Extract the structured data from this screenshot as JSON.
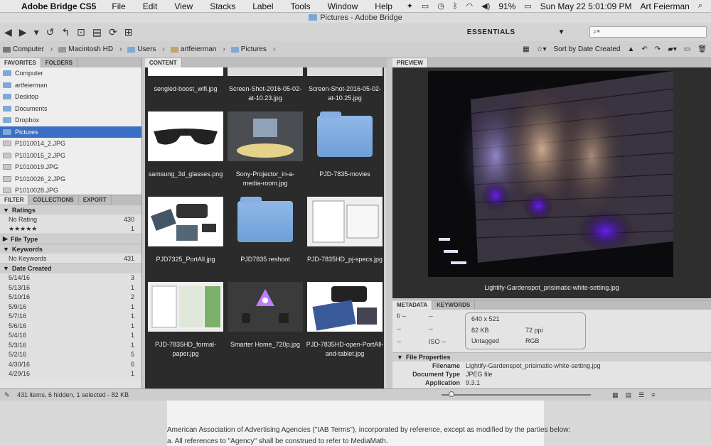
{
  "menubar": {
    "app": "Adobe Bridge CS5",
    "items": [
      "File",
      "Edit",
      "View",
      "Stacks",
      "Label",
      "Tools",
      "Window",
      "Help"
    ],
    "battery": "91%",
    "clock": "Sun May 22  5:01:09 PM",
    "user": "Art Feierman"
  },
  "window": {
    "title": "Pictures - Adobe Bridge"
  },
  "toolbar": {
    "workspace": "ESSENTIALS",
    "search_placeholder": ""
  },
  "pathbar": {
    "crumbs": [
      "Computer",
      "Macintosh HD",
      "Users",
      "artfeierman",
      "Pictures"
    ],
    "sort": "Sort by Date Created"
  },
  "left": {
    "tabs": [
      "FAVORITES",
      "FOLDERS"
    ],
    "favorites": [
      {
        "label": "Computer",
        "type": "folder"
      },
      {
        "label": "artfeierman",
        "type": "folder"
      },
      {
        "label": "Desktop",
        "type": "folder"
      },
      {
        "label": "Documents",
        "type": "folder"
      },
      {
        "label": "Dropbox",
        "type": "folder"
      },
      {
        "label": "Pictures",
        "type": "folder"
      },
      {
        "label": "P1010014_2.JPG",
        "type": "image"
      },
      {
        "label": "P1010015_2.JPG",
        "type": "image"
      },
      {
        "label": "P1010019.JPG",
        "type": "image"
      },
      {
        "label": "P1010026_2.JPG",
        "type": "image"
      },
      {
        "label": "P1010028.JPG",
        "type": "image"
      }
    ],
    "filter_tabs": [
      "FILTER",
      "COLLECTIONS",
      "EXPORT"
    ],
    "ratings_label": "Ratings",
    "no_rating": "No Rating",
    "no_rating_count": "430",
    "five_star": "★★★★★",
    "five_star_count": "1",
    "file_type_label": "File Type",
    "keywords_label": "Keywords",
    "no_keywords": "No Keywords",
    "no_keywords_count": "431",
    "date_created_label": "Date Created",
    "dates": [
      {
        "d": "5/14/16",
        "c": "3"
      },
      {
        "d": "5/13/16",
        "c": "1"
      },
      {
        "d": "5/10/16",
        "c": "2"
      },
      {
        "d": "5/9/16",
        "c": "1"
      },
      {
        "d": "5/7/16",
        "c": "1"
      },
      {
        "d": "5/6/16",
        "c": "1"
      },
      {
        "d": "5/4/16",
        "c": "1"
      },
      {
        "d": "5/3/16",
        "c": "1"
      },
      {
        "d": "5/2/16",
        "c": "5"
      },
      {
        "d": "4/30/16",
        "c": "6"
      },
      {
        "d": "4/29/16",
        "c": "1"
      }
    ]
  },
  "content": {
    "tab": "CONTENT",
    "items": [
      {
        "cap": "sengled-boost_wifi.jpg"
      },
      {
        "cap": "Screen-Shot-2016-05-02-at-10.23.jpg"
      },
      {
        "cap": "Screen-Shot-2016-05-02-at-10.25.jpg"
      },
      {
        "cap": "samsung_3d_glasses.png"
      },
      {
        "cap": "Sony-Projector_in-a-media-room.jpg"
      },
      {
        "cap": "PJD-7835-movies"
      },
      {
        "cap": "PJD7325_PortAll.jpg"
      },
      {
        "cap": "PJD7835 reshoot"
      },
      {
        "cap": "PJD-7835HD_pj-specs.jpg"
      },
      {
        "cap": "PJD-7835HD_formal-paper.jpg"
      },
      {
        "cap": "Smarter Home_720p.jpg"
      },
      {
        "cap": "PJD-7835HD-open-PortAll-and-tablet.jpg"
      }
    ]
  },
  "preview": {
    "tab": "PREVIEW",
    "caption": "Lightify-Gardenspot_prisimatic-white-setting.jpg"
  },
  "metadata": {
    "tabs": [
      "METADATA",
      "KEYWORDS"
    ],
    "cam": [
      "f/ --",
      "--",
      "--",
      "--",
      "--",
      "ISO --"
    ],
    "dims": "640 x 521",
    "size": "82 KB",
    "ppi": "72 ppi",
    "tagged": "Untagged",
    "color": "RGB",
    "section": "File Properties",
    "rows": [
      {
        "k": "Filename",
        "v": "Lightify-Gardenspot_prisimatic-white-setting.jpg"
      },
      {
        "k": "Document Type",
        "v": "JPEG file"
      },
      {
        "k": "Application",
        "v": "9.3.1"
      }
    ]
  },
  "status": {
    "text": "431 items, 6 hidden, 1 selected - 82 KB"
  },
  "doc": {
    "line1": "American Association of Advertising Agencies (\"IAB Terms\"), incorporated by reference, except as modified by the parties below:",
    "line2": "a. All references to \"Agency\" shall be construed to refer to MediaMath."
  }
}
